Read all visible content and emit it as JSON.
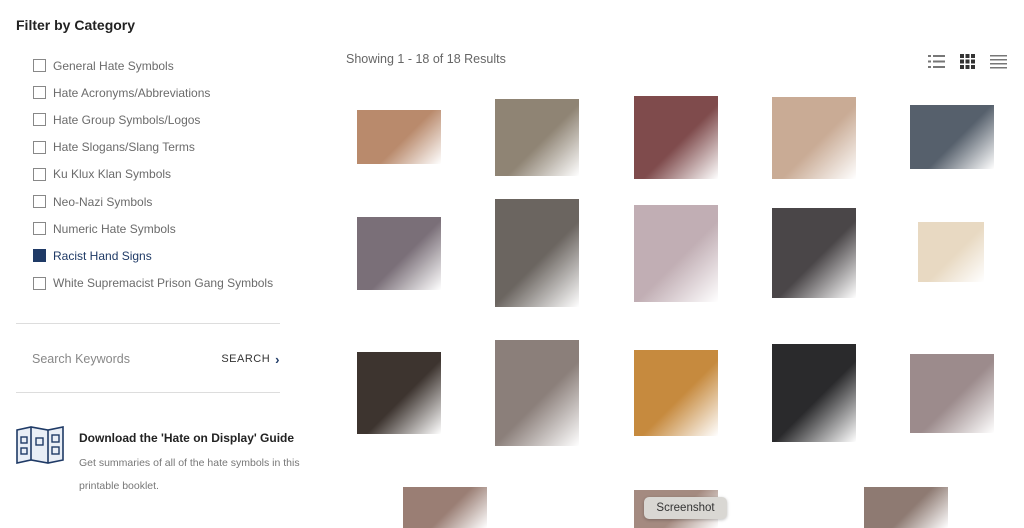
{
  "sidebar": {
    "filter_title": "Filter by Category",
    "categories": [
      {
        "label": "General Hate Symbols",
        "checked": false
      },
      {
        "label": "Hate Acronyms/Abbreviations",
        "checked": false
      },
      {
        "label": "Hate Group Symbols/Logos",
        "checked": false
      },
      {
        "label": "Hate Slogans/Slang Terms",
        "checked": false
      },
      {
        "label": "Ku Klux Klan Symbols",
        "checked": false
      },
      {
        "label": "Neo-Nazi Symbols",
        "checked": false
      },
      {
        "label": "Numeric Hate Symbols",
        "checked": false
      },
      {
        "label": "Racist Hand Signs",
        "checked": true
      },
      {
        "label": "White Supremacist Prison Gang Symbols",
        "checked": false
      }
    ],
    "search": {
      "placeholder": "Search Keywords",
      "button_label": "SEARCH"
    },
    "guide": {
      "title": "Download the 'Hate on Display' Guide",
      "description": "Get summaries of all of the hate symbols in this printable booklet."
    }
  },
  "main": {
    "results_text": "Showing 1 - 18 of 18 Results",
    "view_icons": [
      "list-view-icon",
      "grid-view-icon",
      "text-view-icon"
    ]
  },
  "colors": {
    "accent": "#1f3a66",
    "thumbnails": [
      "#b98a6c",
      "#8f8474",
      "#7f4b4c",
      "#c9ab95",
      "#56606c",
      "#7a6f78",
      "#6b6560",
      "#c1aeb4",
      "#4a4648",
      "#e8d9c2",
      "#3d342f",
      "#8b7f7a",
      "#c68a3e",
      "#2a2a2c",
      "#9c8b8c",
      "#9a7e74",
      "#a48a80",
      "#8e7a72"
    ]
  },
  "tooltip": {
    "label": "Screenshot"
  }
}
